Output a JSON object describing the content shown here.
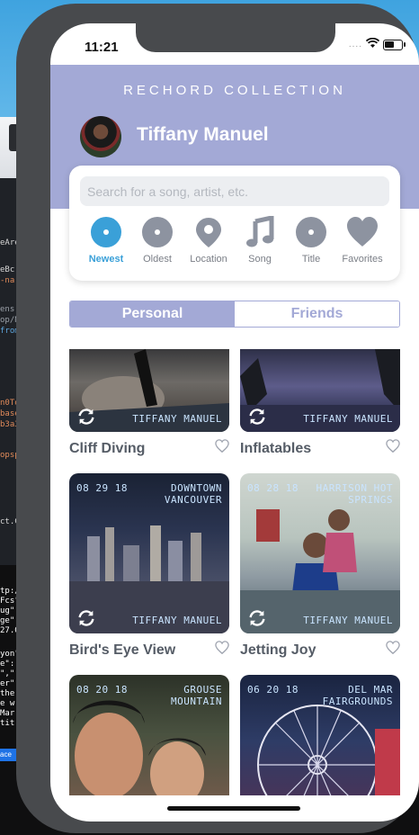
{
  "status_bar": {
    "time": "11:21",
    "signal_dots": "....",
    "battery_level": 0.6
  },
  "header": {
    "collection_title": "RECHORD COLLECTION",
    "user_name": "Tiffany Manuel"
  },
  "search": {
    "placeholder": "Search for a song, artist, etc."
  },
  "filters": [
    {
      "label": "Newest",
      "icon": "record-icon",
      "active": true
    },
    {
      "label": "Oldest",
      "icon": "record-icon",
      "active": false
    },
    {
      "label": "Location",
      "icon": "location-pin-icon",
      "active": false
    },
    {
      "label": "Song",
      "icon": "music-note-icon",
      "active": false
    },
    {
      "label": "Title",
      "icon": "record-icon",
      "active": false
    },
    {
      "label": "Favorites",
      "icon": "heart-icon",
      "active": false
    }
  ],
  "segments": {
    "personal": "Personal",
    "friends": "Friends",
    "selected": "Personal"
  },
  "cards": [
    {
      "title": "Cliff Diving",
      "date": "",
      "location": "",
      "owner": "TIFFANY MANUEL"
    },
    {
      "title": "Inflatables",
      "date": "",
      "location": "",
      "owner": "TIFFANY MANUEL"
    },
    {
      "title": "Bird's Eye View",
      "date": "08 29 18",
      "location_line1": "DOWNTOWN",
      "location_line2": "VANCOUVER",
      "owner": "TIFFANY MANUEL"
    },
    {
      "title": "Jetting Joy",
      "date": "08 28 18",
      "location_line1": "HARRISON HOT",
      "location_line2": "SPRINGS",
      "owner": "TIFFANY MANUEL"
    },
    {
      "title": "",
      "date": "08 20 18",
      "location_line1": "GROUSE",
      "location_line2": "MOUNTAIN",
      "owner": ""
    },
    {
      "title": "",
      "date": "06 20 18",
      "location_line1": "DEL MAR",
      "location_line2": "FAIRGROUNDS",
      "owner": ""
    }
  ],
  "background": {
    "code_lines": [
      "eAre",
      "eBc",
      "-na",
      "ens,",
      "op/N",
      "from",
      "n0To",
      "base",
      "b3a3",
      "opsp",
      "ct.C"
    ],
    "terminal_lines": [
      "tp:/",
      "Fcs\"",
      "ug\":",
      "ge\":",
      "27.0",
      "yon\"",
      "e\":",
      "\",\"",
      "er\":",
      "the",
      "e w",
      "Mar",
      "tit"
    ],
    "chip_text": "ace"
  },
  "colors": {
    "accent": "#a3a9d6",
    "active_filter": "#3aa0d8",
    "inactive_icon": "#8d93a0"
  }
}
